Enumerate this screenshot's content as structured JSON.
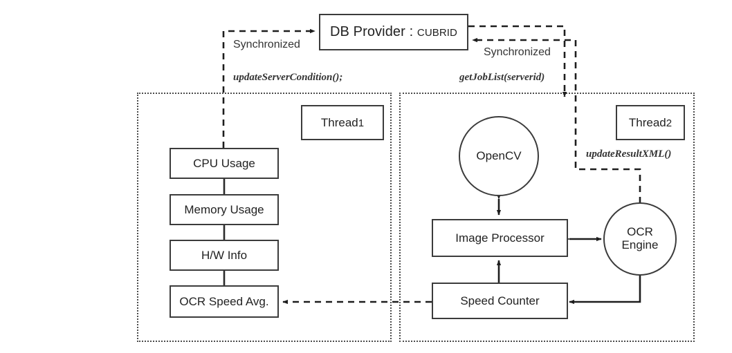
{
  "diagram": {
    "title_node": {
      "label_main": "DB Provider : ",
      "label_sub": "CUBRID"
    },
    "panels": [
      {
        "name": "thread1-panel",
        "thread_label": "Thread",
        "thread_num": "1"
      },
      {
        "name": "thread2-panel",
        "thread_label": "Thread",
        "thread_num": "2"
      }
    ],
    "left_nodes": [
      {
        "label": "CPU Usage"
      },
      {
        "label": "Memory Usage"
      },
      {
        "label": "H/W Info"
      },
      {
        "label": "OCR Speed Avg."
      }
    ],
    "right_nodes": [
      {
        "label": "OpenCV"
      },
      {
        "label": "Image Processor"
      },
      {
        "label_line1": "OCR",
        "label_line2": "Engine"
      },
      {
        "label": "Speed Counter"
      }
    ],
    "edge_labels": {
      "sync_left": "Synchronized",
      "sync_right": "Synchronized",
      "update_server_condition": "updateServerCondition();",
      "get_job_list": "getJobList(serverid)",
      "update_result_xml": "updateResultXML()"
    },
    "colors": {
      "stroke": "#3b3b3b",
      "panel_stroke": "#4a4a4a",
      "text": "#222222",
      "background": "#ffffff"
    }
  }
}
